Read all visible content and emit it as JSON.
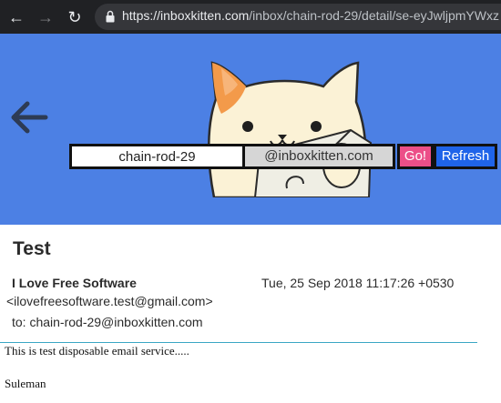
{
  "browser": {
    "url_host": "https://inboxkitten.com",
    "url_path": "/inbox/chain-rod-29/detail/se-eyJwljpmYWxz",
    "back_icon": "arrow-left-icon",
    "forward_icon": "arrow-right-icon",
    "reload_icon": "reload-icon",
    "lock_icon": "lock-icon"
  },
  "hero": {
    "background": "#4c80e4",
    "back_icon": "arrow-left-icon",
    "mascot_icon": "kitten-mascot-icon",
    "inbox_name": "chain-rod-29",
    "domain": "@inboxkitten.com",
    "go_label": "Go!",
    "refresh_label": "Refresh"
  },
  "email": {
    "subject": "Test",
    "from_name": "I Love Free Software",
    "date": "Tue, 25 Sep 2018 11:17:26 +0530",
    "from_email": "<ilovefreesoftware.test@gmail.com>",
    "to": "to: chain-rod-29@inboxkitten.com",
    "body": "This is test disposable email service.....",
    "signature": "Suleman"
  }
}
